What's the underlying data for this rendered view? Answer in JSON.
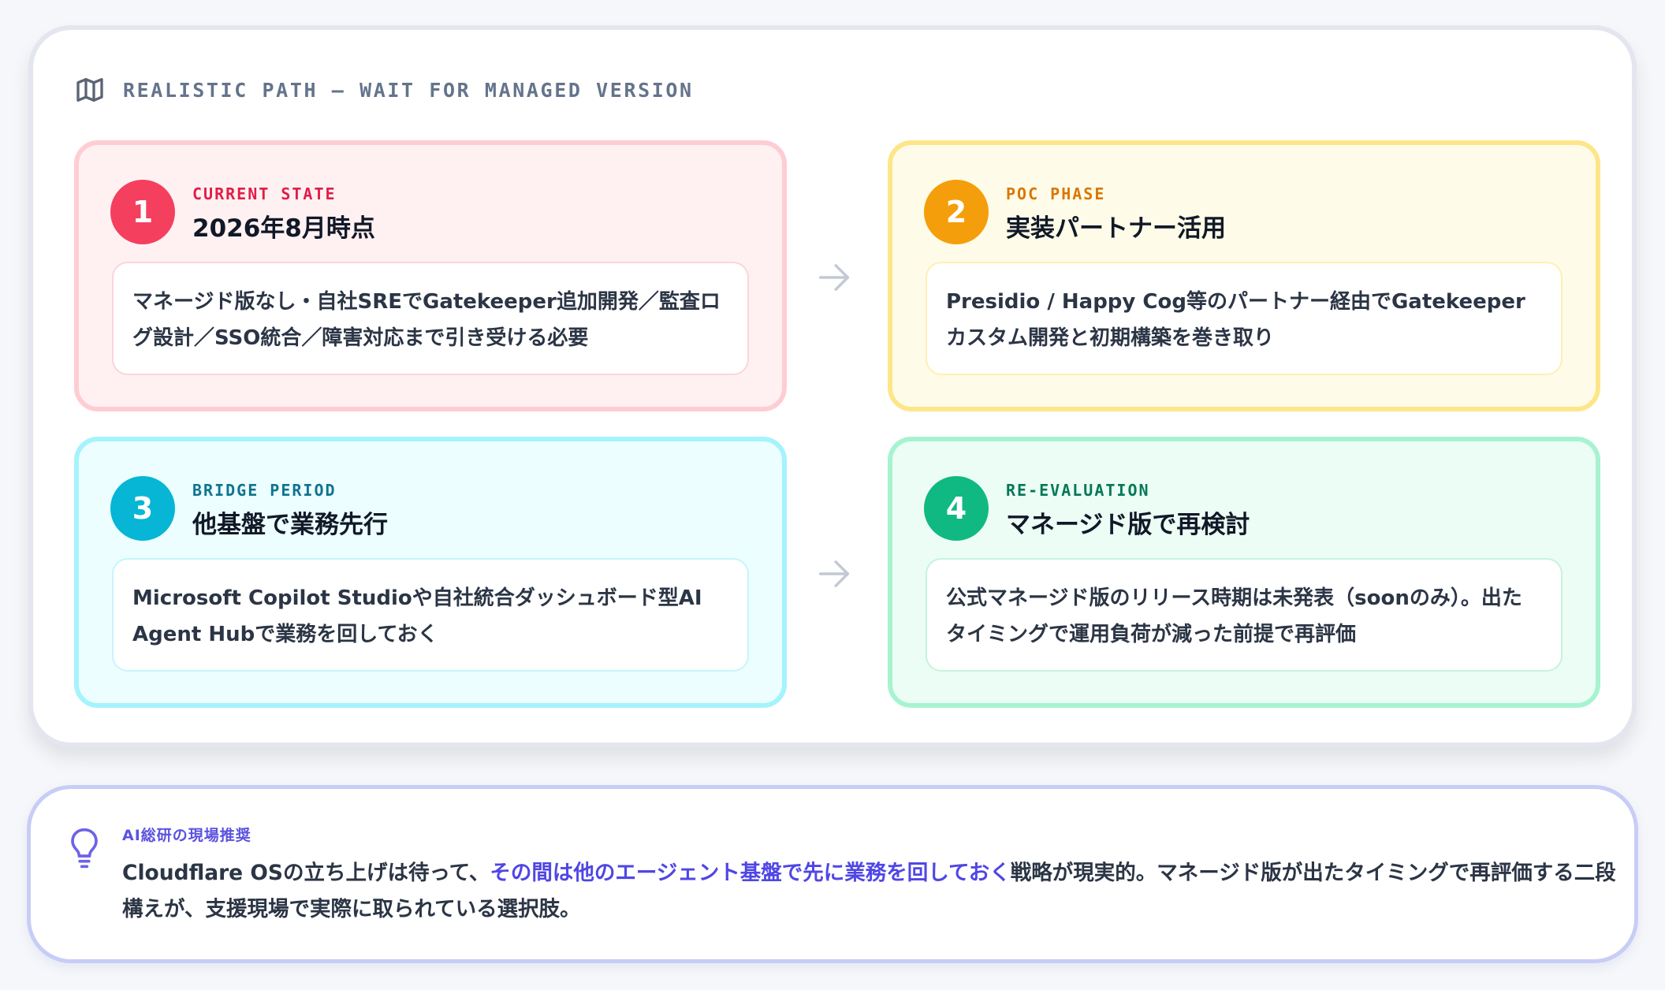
{
  "header": {
    "label": "REALISTIC PATH — WAIT FOR MANAGED VERSION",
    "icon": "map-icon"
  },
  "steps": [
    {
      "number": "1",
      "tag": "CURRENT STATE",
      "title": "2026年8月時点",
      "description": "マネージド版なし・自社SREでGatekeeper追加開発／監査ログ設計／SSO統合／障害対応まで引き受ける必要",
      "color": "#f43f5e"
    },
    {
      "number": "2",
      "tag": "POC PHASE",
      "title": "実装パートナー活用",
      "description": "Presidio / Happy Cog等のパートナー経由でGatekeeperカスタム開発と初期構築を巻き取り",
      "color": "#f59e0b"
    },
    {
      "number": "3",
      "tag": "BRIDGE PERIOD",
      "title": "他基盤で業務先行",
      "description": "Microsoft Copilot Studioや自社統合ダッシュボード型AI Agent Hubで業務を回しておく",
      "color": "#06b6d4"
    },
    {
      "number": "4",
      "tag": "RE-EVALUATION",
      "title": "マネージド版で再検討",
      "description": "公式マネージド版のリリース時期は未発表（soonのみ）。出たタイミングで運用負荷が減った前提で再評価",
      "color": "#10b981"
    }
  ],
  "arrows": [
    "arrow-right-icon",
    "arrow-right-icon"
  ],
  "recommendation": {
    "icon": "lightbulb-icon",
    "tag": "AI総研の現場推奨",
    "text_before": "Cloudflare OSの立ち上げは待って、",
    "text_highlight": "その間は他のエージェント基盤で先に業務を回しておく",
    "text_after": "戦略が現実的。マネージド版が出たタイミングで再評価する二段構えが、支援現場で実際に取られている選択肢。",
    "highlight_color": "#4f46e5"
  }
}
